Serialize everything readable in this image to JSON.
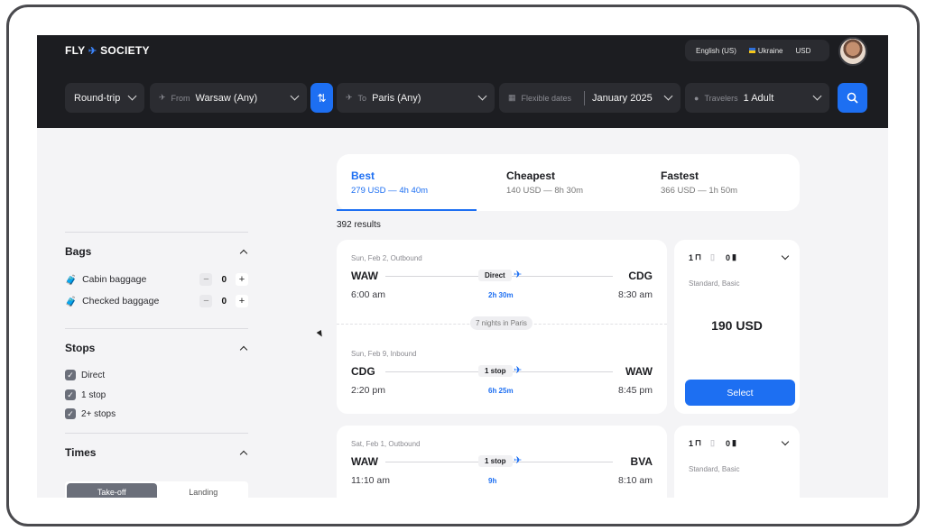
{
  "header": {
    "logo_left": "FLY",
    "logo_right": "SOCIETY",
    "language": "English (US)",
    "country": "Ukraine",
    "currency": "USD"
  },
  "search": {
    "trip_type": "Round-trip",
    "from_label": "From",
    "from_value": "Warsaw (Any)",
    "to_label": "To",
    "to_value": "Paris (Any)",
    "dates_label": "Flexible dates",
    "dates_value": "January 2025",
    "travelers_label": "Travelers",
    "travelers_value": "1 Adult"
  },
  "filters": {
    "bags": {
      "title": "Bags",
      "cabin_label": "Cabin baggage",
      "cabin_value": "0",
      "checked_label": "Checked baggage",
      "checked_value": "0"
    },
    "stops": {
      "title": "Stops",
      "options": [
        "Direct",
        "1 stop",
        "2+ stops"
      ]
    },
    "times": {
      "title": "Times",
      "takeoff": "Take-off",
      "landing": "Landing"
    }
  },
  "sort": {
    "best": {
      "label": "Best",
      "detail": "279 USD — 4h 40m"
    },
    "cheapest": {
      "label": "Cheapest",
      "detail": "140 USD — 8h 30m"
    },
    "fastest": {
      "label": "Fastest",
      "detail": "366 USD — 1h 50m"
    }
  },
  "results_count": "392 results",
  "flights": [
    {
      "outbound": {
        "date": "Sun, Feb 2, Outbound",
        "from": "WAW",
        "to": "CDG",
        "stops": "Direct",
        "depart": "6:00 am",
        "arrive": "8:30 am",
        "duration": "2h 30m"
      },
      "stay": "7 nights in Paris",
      "inbound": {
        "date": "Sun, Feb 9, Inbound",
        "from": "CDG",
        "to": "WAW",
        "stops": "1 stop",
        "depart": "2:20 pm",
        "arrive": "8:45 pm",
        "duration": "6h 25m"
      },
      "cabin_bags": "1",
      "checked_bags": "0",
      "fare": "Standard, Basic",
      "price": "190 USD",
      "select": "Select"
    },
    {
      "outbound": {
        "date": "Sat, Feb 1, Outbound",
        "from": "WAW",
        "to": "BVA",
        "stops": "1 stop",
        "depart": "11:10 am",
        "arrive": "8:10 am",
        "duration": "9h"
      },
      "cabin_bags": "1",
      "checked_bags": "0",
      "fare": "Standard, Basic"
    }
  ]
}
